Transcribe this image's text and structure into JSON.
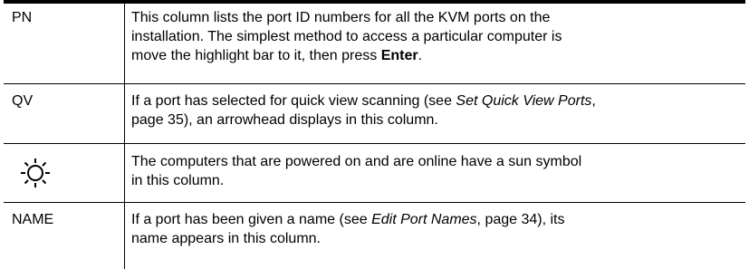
{
  "rows": [
    {
      "term": "PN",
      "desc_line1": "This column lists the port ID numbers for all the KVM ports on the",
      "desc_line2": "installation. The simplest method to access a particular computer is",
      "desc_line3_pre": "move the highlight bar to it, then press ",
      "desc_line3_bold": "Enter",
      "desc_line3_post": "."
    },
    {
      "term": "QV",
      "desc_line1_pre": "If a port has selected for quick view scanning (see ",
      "desc_line1_italic": "Set Quick View Ports",
      "desc_line1_post": ",",
      "desc_line2": "page 35), an arrowhead displays in this column."
    },
    {
      "term_icon": "sun-icon",
      "desc_line1": "The computers that are powered on and are online have a sun symbol",
      "desc_line2": "in this column."
    },
    {
      "term": "NAME",
      "desc_line1_pre": "If a port has been given a name (see ",
      "desc_line1_italic": "Edit Port Names",
      "desc_line1_post": ", page 34), its",
      "desc_line2": "name appears in this column."
    }
  ]
}
